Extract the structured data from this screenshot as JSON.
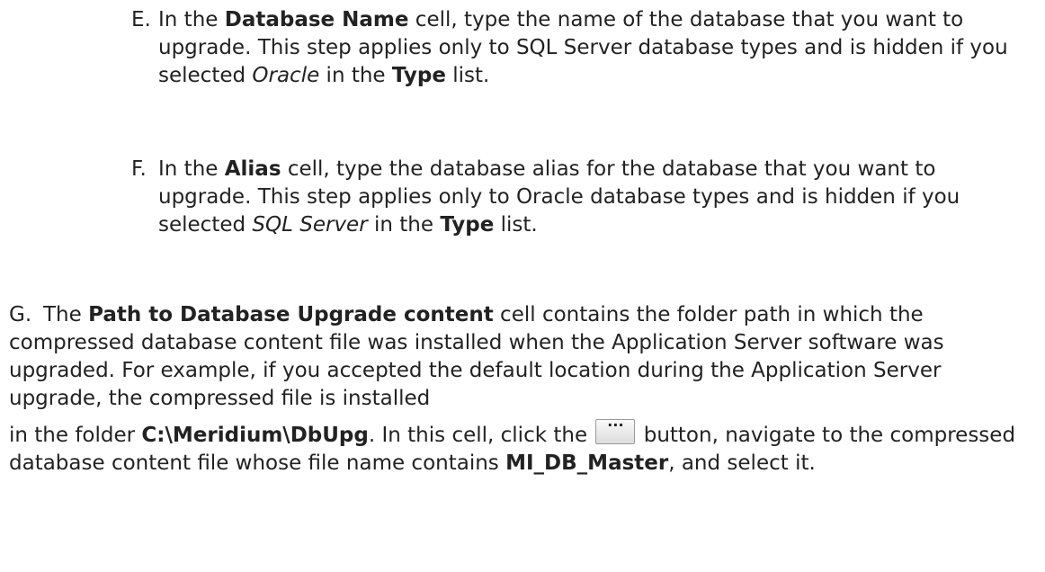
{
  "steps": {
    "e": {
      "marker": "E.",
      "t1": "In the ",
      "b1": "Database Name",
      "t2": " cell, type the name of the database that you want to upgrade. This step applies only to SQL Server database types and is hidden if you selected ",
      "i1": "Oracle",
      "t3": " in the ",
      "b2": "Type",
      "t4": " list."
    },
    "f": {
      "marker": "F.",
      "t1": "In the ",
      "b1": "Alias",
      "t2": " cell, type the database alias for the database that you want to upgrade. This step applies only to Oracle database types and is hidden if you selected ",
      "i1": "SQL Server",
      "t3": " in the ",
      "b2": "Type",
      "t4": " list."
    },
    "g": {
      "marker": "G.",
      "t1": "The ",
      "b1": "Path to Database Upgrade content",
      "t2": " cell contains the folder path in which the compressed database content file was installed when the Application Server software was upgraded. For example, if you accepted the default location during the Application Server upgrade, the compressed file is installed",
      "t3": "in the folder ",
      "b2": "C:\\Meridium\\DbUpg",
      "t4": ". In this cell, click the ",
      "button_label": "...",
      "t5": " button, navigate to the compressed database content file whose file name contains ",
      "b3": "MI_DB_Master",
      "t6": ", and select it."
    }
  }
}
